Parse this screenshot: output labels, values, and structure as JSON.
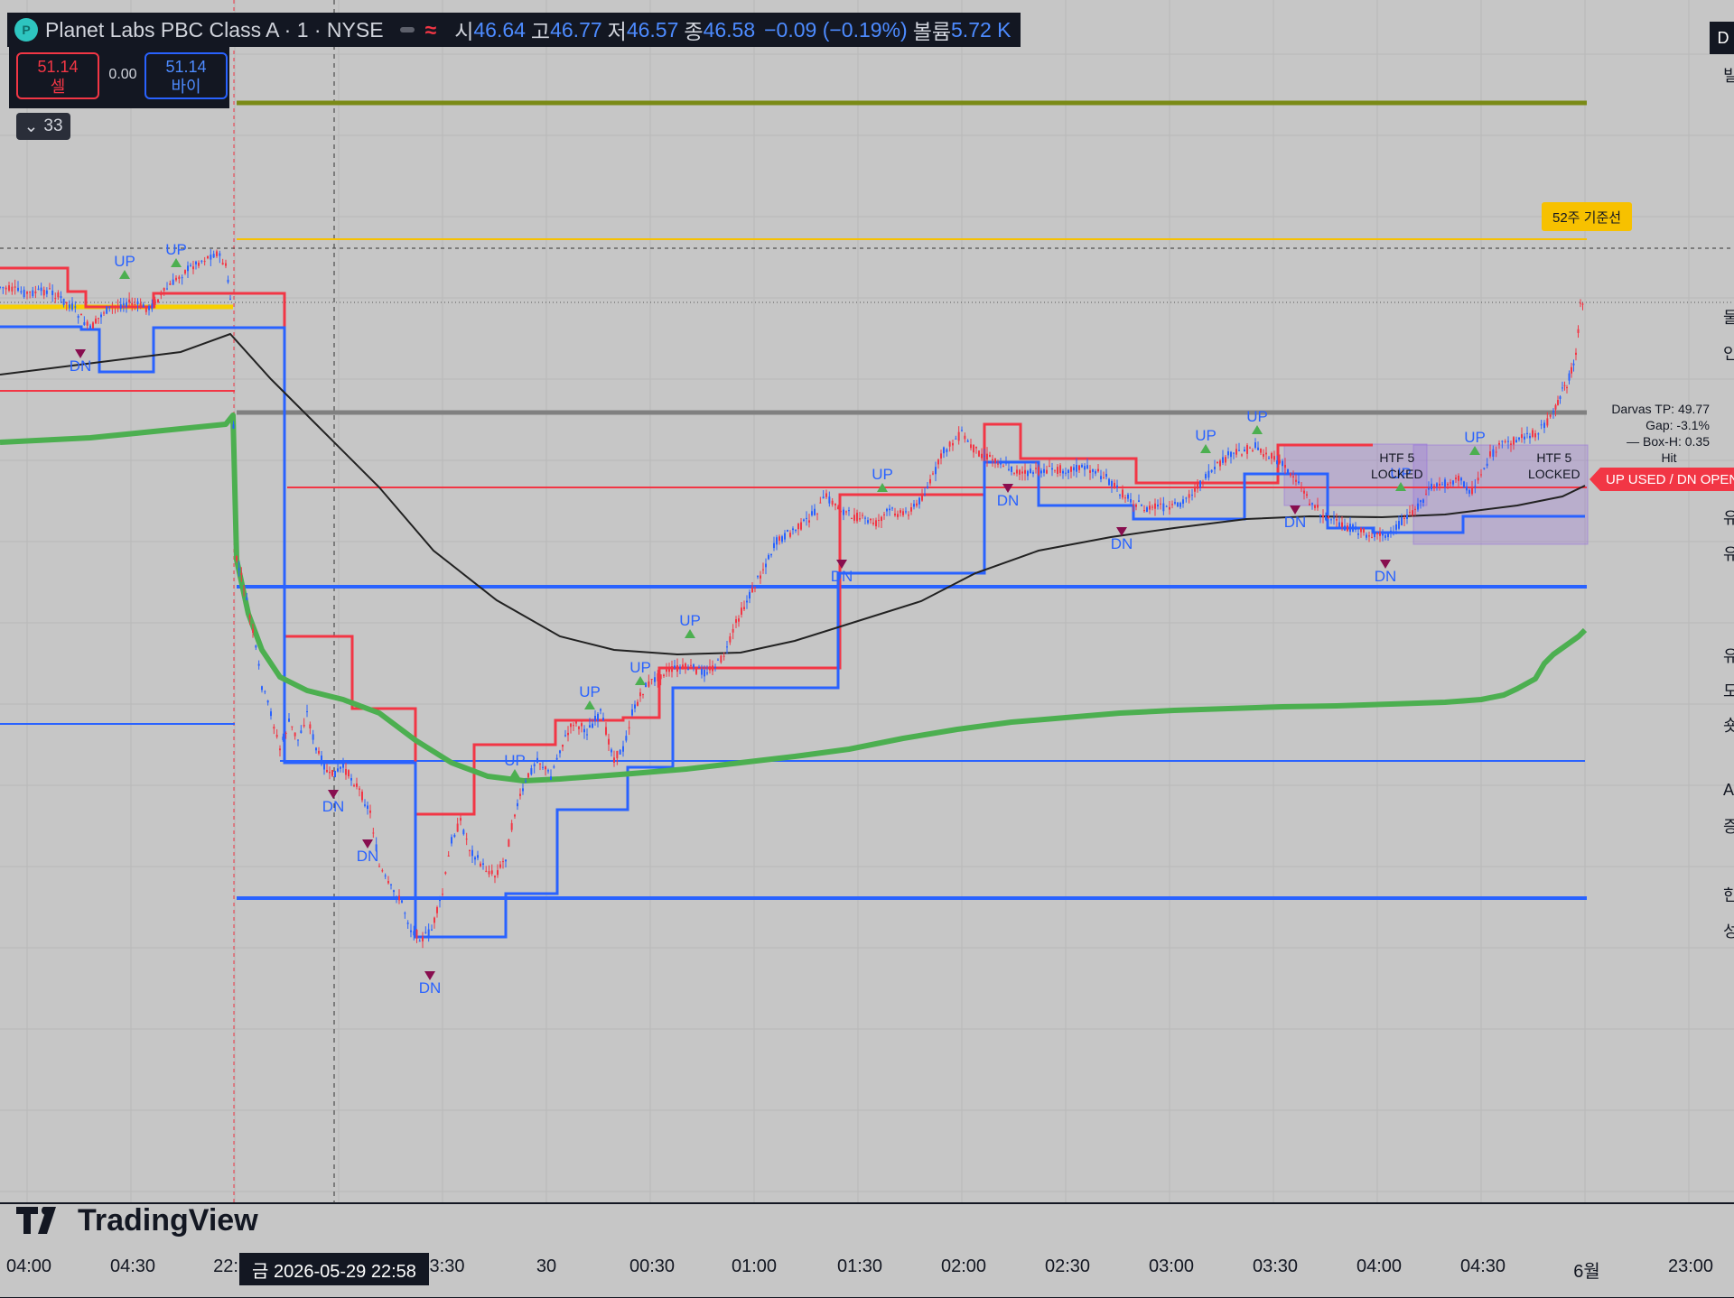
{
  "header": {
    "symbol": "Planet Labs PBC Class A · 1 · NYSE",
    "open_label": "시",
    "open": "46.64",
    "high_label": "고",
    "high": "46.77",
    "low_label": "저",
    "low": "46.57",
    "close_label": "종",
    "close": "46.58",
    "change": "−0.09 (−0.19%)",
    "volume_label": "볼륨",
    "volume": "5.72 K"
  },
  "trade": {
    "sell_price": "51.14",
    "sell_label": "셀",
    "spread": "0.00",
    "buy_price": "51.14",
    "buy_label": "바이"
  },
  "indicator_count": "33",
  "watermark": "TradingView",
  "crosshair_date": "금 2026-05-29   22:58",
  "right_glyphs": [
    "빌",
    "물",
    "인",
    "유",
    "유",
    "유",
    "도",
    "숏",
    "A",
    "증",
    "한",
    "성"
  ],
  "colors": {
    "background": "#c6c6c6",
    "up_box": "#f23645",
    "dn_box": "#2962ff",
    "vwap": "#4caf50",
    "ema": "#222222",
    "level_olive": "#7a8a16",
    "level_gray": "#808080",
    "ref52": "#f7c100"
  },
  "chart_data": {
    "type": "candlestick",
    "title": "Planet Labs PBC Class A · 1 · NYSE",
    "xlabel": "",
    "ylabel": "",
    "x_ticks": [
      "04:00",
      "04:30",
      "22:",
      "3:30",
      "30",
      "00:30",
      "01:00",
      "01:30",
      "02:00",
      "02:30",
      "03:00",
      "03:30",
      "04:00",
      "04:30",
      "6월",
      "23:00"
    ],
    "ohlc_last": {
      "open": 46.64,
      "high": 46.77,
      "low": 46.57,
      "close": 46.58,
      "volume": "5.72 K"
    },
    "price_path": [
      [
        0,
        318
      ],
      [
        30,
        325
      ],
      [
        55,
        322
      ],
      [
        80,
        340
      ],
      [
        100,
        365
      ],
      [
        115,
        345
      ],
      [
        140,
        335
      ],
      [
        165,
        342
      ],
      [
        185,
        320
      ],
      [
        205,
        300
      ],
      [
        220,
        290
      ],
      [
        240,
        280
      ],
      [
        250,
        295
      ],
      [
        255,
        330
      ],
      [
        262,
        620
      ],
      [
        270,
        650
      ],
      [
        280,
        700
      ],
      [
        290,
        760
      ],
      [
        300,
        790
      ],
      [
        310,
        830
      ],
      [
        320,
        800
      ],
      [
        330,
        820
      ],
      [
        340,
        790
      ],
      [
        350,
        830
      ],
      [
        365,
        860
      ],
      [
        380,
        850
      ],
      [
        395,
        870
      ],
      [
        410,
        900
      ],
      [
        420,
        960
      ],
      [
        430,
        980
      ],
      [
        445,
        1000
      ],
      [
        455,
        1030
      ],
      [
        468,
        1040
      ],
      [
        478,
        1030
      ],
      [
        490,
        990
      ],
      [
        500,
        930
      ],
      [
        510,
        910
      ],
      [
        520,
        940
      ],
      [
        535,
        960
      ],
      [
        548,
        970
      ],
      [
        560,
        950
      ],
      [
        570,
        900
      ],
      [
        585,
        860
      ],
      [
        595,
        840
      ],
      [
        610,
        860
      ],
      [
        620,
        830
      ],
      [
        635,
        800
      ],
      [
        650,
        810
      ],
      [
        665,
        790
      ],
      [
        680,
        840
      ],
      [
        690,
        830
      ],
      [
        700,
        790
      ],
      [
        715,
        760
      ],
      [
        735,
        745
      ],
      [
        750,
        740
      ],
      [
        765,
        740
      ],
      [
        780,
        745
      ],
      [
        795,
        735
      ],
      [
        805,
        720
      ],
      [
        815,
        690
      ],
      [
        830,
        660
      ],
      [
        845,
        630
      ],
      [
        860,
        600
      ],
      [
        875,
        590
      ],
      [
        890,
        580
      ],
      [
        905,
        565
      ],
      [
        915,
        550
      ],
      [
        925,
        560
      ],
      [
        940,
        570
      ],
      [
        955,
        575
      ],
      [
        970,
        580
      ],
      [
        985,
        565
      ],
      [
        1000,
        570
      ],
      [
        1015,
        560
      ],
      [
        1030,
        535
      ],
      [
        1045,
        500
      ],
      [
        1055,
        490
      ],
      [
        1065,
        480
      ],
      [
        1075,
        495
      ],
      [
        1090,
        505
      ],
      [
        1105,
        510
      ],
      [
        1120,
        520
      ],
      [
        1135,
        525
      ],
      [
        1150,
        522
      ],
      [
        1165,
        520
      ],
      [
        1180,
        520
      ],
      [
        1195,
        518
      ],
      [
        1210,
        520
      ],
      [
        1225,
        530
      ],
      [
        1240,
        545
      ],
      [
        1255,
        555
      ],
      [
        1270,
        565
      ],
      [
        1285,
        560
      ],
      [
        1295,
        565
      ],
      [
        1310,
        555
      ],
      [
        1320,
        545
      ],
      [
        1335,
        530
      ],
      [
        1345,
        520
      ],
      [
        1360,
        505
      ],
      [
        1375,
        500
      ],
      [
        1390,
        495
      ],
      [
        1405,
        505
      ],
      [
        1420,
        515
      ],
      [
        1435,
        530
      ],
      [
        1450,
        555
      ],
      [
        1465,
        570
      ],
      [
        1480,
        580
      ],
      [
        1495,
        585
      ],
      [
        1510,
        590
      ],
      [
        1525,
        595
      ],
      [
        1540,
        590
      ],
      [
        1555,
        575
      ],
      [
        1570,
        560
      ],
      [
        1585,
        540
      ],
      [
        1600,
        535
      ],
      [
        1615,
        530
      ],
      [
        1630,
        545
      ],
      [
        1640,
        525
      ],
      [
        1650,
        505
      ],
      [
        1660,
        495
      ],
      [
        1670,
        490
      ],
      [
        1685,
        485
      ],
      [
        1700,
        480
      ],
      [
        1710,
        470
      ],
      [
        1720,
        460
      ],
      [
        1725,
        445
      ],
      [
        1730,
        430
      ],
      [
        1735,
        425
      ],
      [
        1740,
        410
      ],
      [
        1745,
        395
      ],
      [
        1750,
        340
      ],
      [
        1755,
        330
      ]
    ],
    "ema_path": [
      [
        0,
        415
      ],
      [
        120,
        400
      ],
      [
        200,
        390
      ],
      [
        255,
        370
      ],
      [
        300,
        420
      ],
      [
        350,
        470
      ],
      [
        420,
        540
      ],
      [
        480,
        610
      ],
      [
        550,
        665
      ],
      [
        620,
        705
      ],
      [
        680,
        720
      ],
      [
        750,
        725
      ],
      [
        820,
        723
      ],
      [
        880,
        710
      ],
      [
        950,
        688
      ],
      [
        1020,
        666
      ],
      [
        1080,
        635
      ],
      [
        1150,
        610
      ],
      [
        1230,
        595
      ],
      [
        1300,
        585
      ],
      [
        1380,
        575
      ],
      [
        1450,
        572
      ],
      [
        1530,
        573
      ],
      [
        1600,
        570
      ],
      [
        1680,
        560
      ],
      [
        1730,
        550
      ],
      [
        1755,
        538
      ]
    ],
    "vwap_path": [
      [
        0,
        490
      ],
      [
        100,
        485
      ],
      [
        200,
        475
      ],
      [
        250,
        470
      ],
      [
        258,
        460
      ],
      [
        262,
        620
      ],
      [
        275,
        680
      ],
      [
        290,
        720
      ],
      [
        310,
        750
      ],
      [
        340,
        765
      ],
      [
        380,
        775
      ],
      [
        420,
        790
      ],
      [
        460,
        820
      ],
      [
        500,
        845
      ],
      [
        540,
        860
      ],
      [
        580,
        865
      ],
      [
        620,
        863
      ],
      [
        660,
        860
      ],
      [
        700,
        857
      ],
      [
        760,
        852
      ],
      [
        820,
        845
      ],
      [
        880,
        838
      ],
      [
        940,
        830
      ],
      [
        1000,
        818
      ],
      [
        1060,
        808
      ],
      [
        1120,
        800
      ],
      [
        1180,
        795
      ],
      [
        1240,
        790
      ],
      [
        1300,
        787
      ],
      [
        1360,
        785
      ],
      [
        1420,
        783
      ],
      [
        1480,
        782
      ],
      [
        1540,
        780
      ],
      [
        1600,
        778
      ],
      [
        1640,
        775
      ],
      [
        1665,
        770
      ],
      [
        1680,
        763
      ],
      [
        1700,
        752
      ],
      [
        1710,
        735
      ],
      [
        1720,
        725
      ],
      [
        1748,
        705
      ],
      [
        1755,
        698
      ]
    ],
    "levels": [
      {
        "y": 114,
        "x1": 262,
        "x2": 1757,
        "color": "#7a8a16",
        "w": 5
      },
      {
        "y": 265,
        "x1": 262,
        "x2": 1757,
        "color": "#f7c100",
        "w": 2
      },
      {
        "y": 457,
        "x1": 262,
        "x2": 1757,
        "color": "#808080",
        "w": 5
      },
      {
        "y": 540,
        "x1": 318,
        "x2": 1757,
        "color": "#f23645",
        "w": 2
      },
      {
        "y": 650,
        "x1": 262,
        "x2": 1757,
        "color": "#2962ff",
        "w": 4
      },
      {
        "y": 843,
        "x1": 310,
        "x2": 1755,
        "color": "#2962ff",
        "w": 2
      },
      {
        "y": 995,
        "x1": 262,
        "x2": 1757,
        "color": "#2962ff",
        "w": 4
      },
      {
        "y": 433,
        "x1": 0,
        "x2": 260,
        "color": "#f23645",
        "w": 2
      },
      {
        "y": 802,
        "x1": 0,
        "x2": 260,
        "color": "#2962ff",
        "w": 2
      }
    ],
    "step_red": [
      [
        0,
        297
      ],
      [
        75,
        297
      ],
      [
        75,
        323
      ],
      [
        95,
        323
      ],
      [
        95,
        340
      ],
      [
        170,
        340
      ],
      [
        170,
        325
      ],
      [
        258,
        325
      ],
      [
        258,
        325
      ],
      [
        315,
        325
      ],
      [
        315,
        705
      ],
      [
        390,
        705
      ],
      [
        390,
        785
      ],
      [
        460,
        785
      ],
      [
        460,
        902
      ],
      [
        525,
        902
      ],
      [
        525,
        825
      ],
      [
        615,
        825
      ],
      [
        615,
        798
      ],
      [
        690,
        798
      ],
      [
        690,
        795
      ],
      [
        730,
        795
      ],
      [
        730,
        740
      ],
      [
        805,
        740
      ],
      [
        805,
        740
      ],
      [
        930,
        740
      ],
      [
        930,
        548
      ],
      [
        975,
        548
      ],
      [
        975,
        548
      ],
      [
        1090,
        548
      ],
      [
        1090,
        470
      ],
      [
        1130,
        470
      ],
      [
        1130,
        508
      ],
      [
        1258,
        508
      ],
      [
        1258,
        535
      ],
      [
        1330,
        535
      ],
      [
        1330,
        535
      ],
      [
        1415,
        535
      ],
      [
        1415,
        493
      ],
      [
        1520,
        493
      ]
    ],
    "step_blue": [
      [
        0,
        362
      ],
      [
        90,
        362
      ],
      [
        90,
        365
      ],
      [
        110,
        365
      ],
      [
        110,
        412
      ],
      [
        170,
        412
      ],
      [
        170,
        363
      ],
      [
        315,
        363
      ],
      [
        315,
        845
      ],
      [
        375,
        845
      ],
      [
        375,
        845
      ],
      [
        460,
        845
      ],
      [
        460,
        1038
      ],
      [
        560,
        1038
      ],
      [
        560,
        990
      ],
      [
        617,
        990
      ],
      [
        617,
        897
      ],
      [
        695,
        897
      ],
      [
        695,
        850
      ],
      [
        745,
        850
      ],
      [
        745,
        762
      ],
      [
        928,
        762
      ],
      [
        928,
        635
      ],
      [
        1090,
        635
      ],
      [
        1090,
        512
      ],
      [
        1150,
        512
      ],
      [
        1150,
        560
      ],
      [
        1255,
        560
      ],
      [
        1255,
        575
      ],
      [
        1378,
        575
      ],
      [
        1378,
        525
      ],
      [
        1430,
        525
      ],
      [
        1430,
        525
      ],
      [
        1470,
        525
      ],
      [
        1470,
        585
      ],
      [
        1520,
        585
      ],
      [
        1520,
        590
      ],
      [
        1620,
        590
      ],
      [
        1620,
        572
      ],
      [
        1755,
        572
      ]
    ],
    "boxes": [
      [
        1422,
        492,
        1580,
        560
      ],
      [
        1565,
        493,
        1758,
        603
      ]
    ],
    "signals": [
      {
        "t": "UP",
        "x": 138,
        "y": 295
      },
      {
        "t": "UP",
        "x": 195,
        "y": 282
      },
      {
        "t": "DN",
        "x": 89,
        "y": 405
      },
      {
        "t": "DN",
        "x": 369,
        "y": 893
      },
      {
        "t": "DN",
        "x": 407,
        "y": 948
      },
      {
        "t": "DN",
        "x": 476,
        "y": 1094
      },
      {
        "t": "UP",
        "x": 570,
        "y": 848
      },
      {
        "t": "UP",
        "x": 653,
        "y": 772
      },
      {
        "t": "UP",
        "x": 709,
        "y": 745
      },
      {
        "t": "UP",
        "x": 764,
        "y": 693
      },
      {
        "t": "UP",
        "x": 977,
        "y": 531
      },
      {
        "t": "DN",
        "x": 932,
        "y": 638
      },
      {
        "t": "DN",
        "x": 1116,
        "y": 554
      },
      {
        "t": "UP",
        "x": 1335,
        "y": 488
      },
      {
        "t": "UP",
        "x": 1392,
        "y": 467
      },
      {
        "t": "DN",
        "x": 1242,
        "y": 602
      },
      {
        "t": "DN",
        "x": 1434,
        "y": 578
      },
      {
        "t": "UP",
        "x": 1551,
        "y": 530
      },
      {
        "t": "DN",
        "x": 1534,
        "y": 638
      },
      {
        "t": "UP",
        "x": 1633,
        "y": 490
      }
    ]
  },
  "annotations": {
    "ref52_label": "52주 기준선",
    "darvas_tp": "Darvas TP: 49.77",
    "gap": "Gap: -3.1%",
    "box_h": "— Box-H: 0.35",
    "hit": "Hit",
    "htf1": "HTF 5",
    "locked1": "LOCKED",
    "htf2": "HTF 5",
    "locked2": "LOCKED",
    "status_tag": "UP USED / DN OPEN"
  }
}
